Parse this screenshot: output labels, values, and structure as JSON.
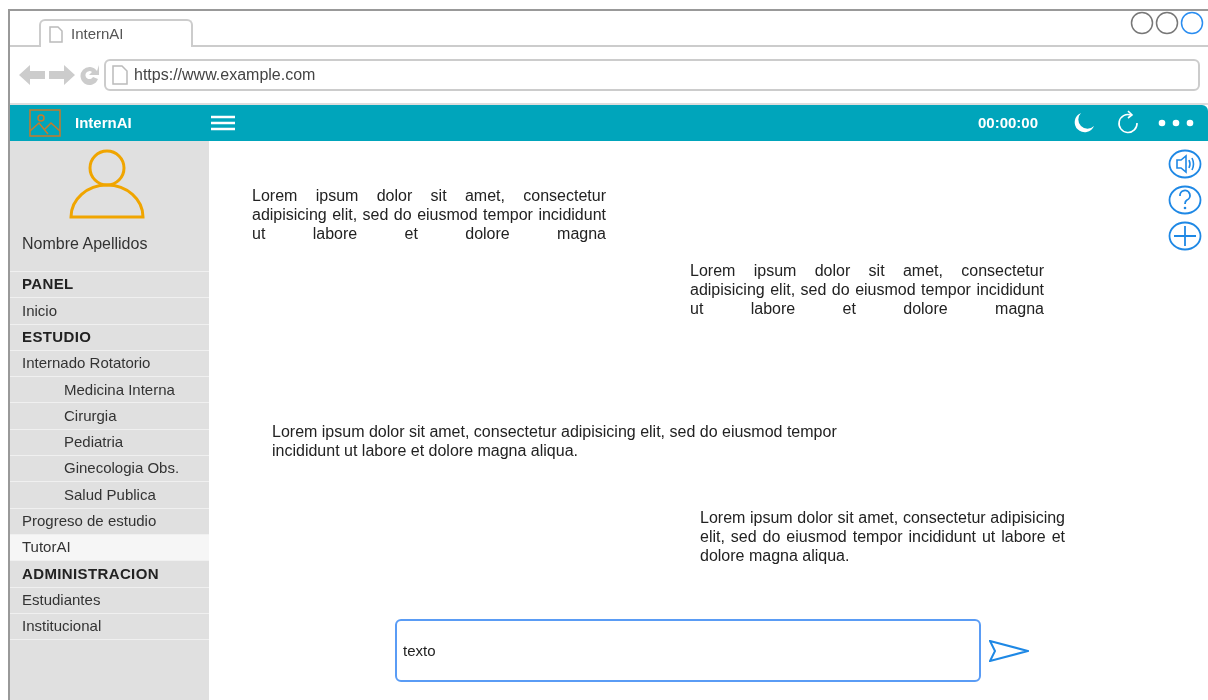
{
  "browser": {
    "tab_title": "InternAI",
    "url": "https://www.example.com"
  },
  "app_bar": {
    "title": "InternAI",
    "timer": "00:00:00"
  },
  "profile": {
    "name": "Nombre Apellidos"
  },
  "sidebar": {
    "items": [
      {
        "kind": "header",
        "label": "PANEL",
        "selected": false
      },
      {
        "kind": "item",
        "label": "Inicio",
        "selected": false
      },
      {
        "kind": "header",
        "label": "ESTUDIO",
        "selected": false
      },
      {
        "kind": "item",
        "label": "Internado Rotatorio",
        "selected": false
      },
      {
        "kind": "subitem",
        "label": "Medicina Interna",
        "selected": false
      },
      {
        "kind": "subitem",
        "label": "Cirurgia",
        "selected": false
      },
      {
        "kind": "subitem",
        "label": "Pediatria",
        "selected": false
      },
      {
        "kind": "subitem",
        "label": "Ginecologia Obs.",
        "selected": false
      },
      {
        "kind": "subitem",
        "label": "Salud Publica",
        "selected": false
      },
      {
        "kind": "item",
        "label": "Progreso de estudio",
        "selected": false
      },
      {
        "kind": "item",
        "label": "TutorAI",
        "selected": true
      },
      {
        "kind": "header",
        "label": "ADMINISTRACION",
        "selected": false
      },
      {
        "kind": "item",
        "label": "Estudiantes",
        "selected": false
      },
      {
        "kind": "item",
        "label": "Institucional",
        "selected": false
      }
    ]
  },
  "messages": [
    {
      "text": "Lorem ipsum dolor sit amet, consectetur adipisicing elit, sed do eiusmod tempor incididunt ut labore et dolore magna"
    },
    {
      "text": "Lorem ipsum dolor sit amet, consectetur adipisicing elit, sed do eiusmod tempor incididunt ut labore et dolore magna"
    },
    {
      "text": "Lorem ipsum dolor sit amet, consectetur adipisicing elit, sed do eiusmod tempor incididunt ut labore et dolore magna aliqua."
    },
    {
      "text": "Lorem ipsum dolor sit amet, consectetur adipisicing elit, sed do eiusmod tempor incididunt ut labore et dolore magna aliqua."
    }
  ],
  "composer": {
    "value": "texto"
  }
}
